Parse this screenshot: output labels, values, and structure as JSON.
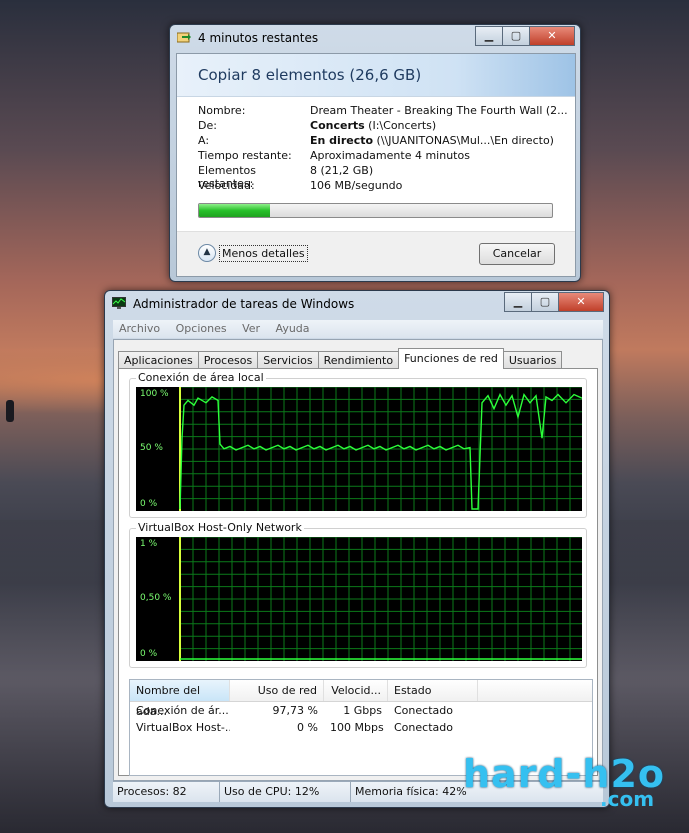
{
  "copy_dialog": {
    "window_title": "4 minutos restantes",
    "heading": "Copiar 8 elementos (26,6 GB)",
    "rows": [
      {
        "label": "Nombre:",
        "value": "Dream Theater - Breaking The Fourth Wall (2..."
      },
      {
        "label": "De:",
        "value_bold": "Concerts",
        "value": " (I:\\Concerts)"
      },
      {
        "label": "A:",
        "value_bold": "En directo",
        "value": " (\\\\JUANITONAS\\Mul...\\En directo)"
      },
      {
        "label": "Tiempo restante:",
        "value": "Aproximadamente 4 minutos"
      },
      {
        "label": "Elementos restantes:",
        "value": "8 (21,2 GB)"
      },
      {
        "label": "Velocidad:",
        "value": "106 MB/segundo"
      }
    ],
    "progress_fraction": 0.2,
    "progress_color": "#28c12a",
    "details_label": "Menos detalles",
    "cancel_label": "Cancelar"
  },
  "task_manager": {
    "window_title": "Administrador de tareas de Windows",
    "menu": [
      "Archivo",
      "Opciones",
      "Ver",
      "Ayuda"
    ],
    "tabs": [
      "Aplicaciones",
      "Procesos",
      "Servicios",
      "Rendimiento",
      "Funciones de red",
      "Usuarios"
    ],
    "active_tab": "Funciones de red",
    "graphs": [
      {
        "title": "Conexión de área local",
        "y_labels": [
          "100 %",
          "50 %",
          "0 %"
        ]
      },
      {
        "title": "VirtualBox Host-Only Network",
        "y_labels": [
          "1 %",
          "0,50 %",
          "0 %"
        ]
      }
    ],
    "table": {
      "columns": [
        "Nombre del ada...",
        "Uso de red",
        "Velocid...",
        "Estado"
      ],
      "rows": [
        [
          "Conexión de ár...",
          "97,73 %",
          "1 Gbps",
          "Conectado"
        ],
        [
          "VirtualBox Host-...",
          "0 %",
          "100 Mbps",
          "Conectado"
        ]
      ]
    },
    "status": {
      "processes": "Procesos: 82",
      "cpu": "Uso de CPU: 12%",
      "memory": "Memoria física: 42%"
    }
  },
  "watermark": {
    "main": "hard-h2o",
    "sub": ".com"
  },
  "colors": {
    "graph_line": "#2cff3a",
    "graph_grid": "#0b7a1a"
  }
}
